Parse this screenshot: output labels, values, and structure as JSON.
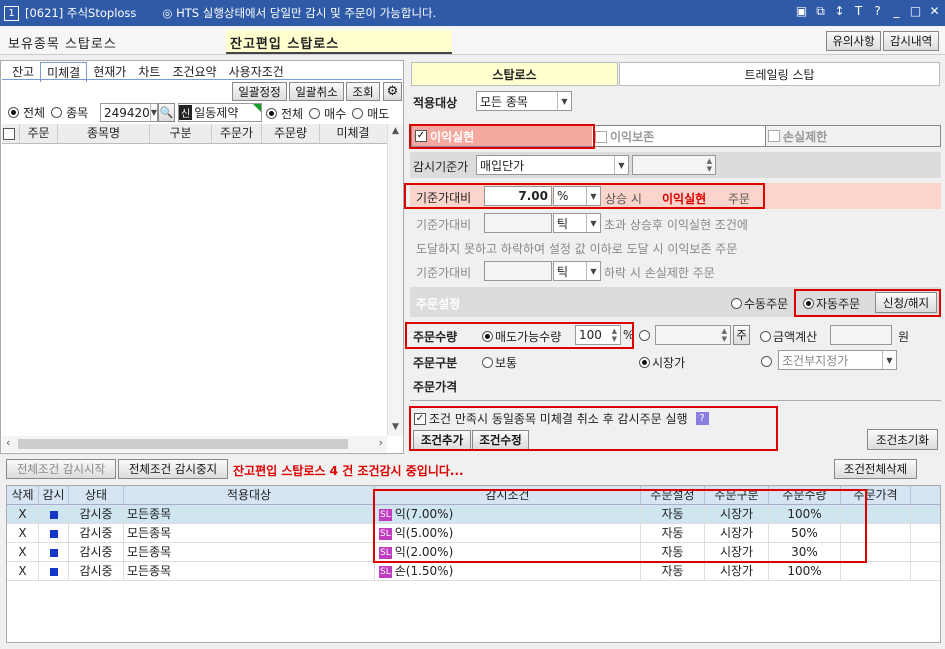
{
  "window": {
    "number": "1",
    "title": "[0621] 주식Stoploss",
    "notice": "◎ HTS 실행상태에서 당일만 감시 및 주문이 가능합니다.",
    "controls": [
      "▣",
      "⧉",
      "↕",
      "T",
      "?",
      "_",
      "□",
      "✕"
    ]
  },
  "header": {
    "holding_label": "보유종목 스탑로스",
    "balance_label": "잔고편입 스탑로스",
    "notice_button": "유의사항",
    "history_button": "감시내역"
  },
  "left": {
    "tabs": [
      "잔고",
      "미체결",
      "현재가",
      "차트",
      "조건요약",
      "사용자조건"
    ],
    "active_tab": "미체결",
    "buttons": {
      "bulk_modify": "일괄정정",
      "bulk_cancel": "일괄취소",
      "query": "조회"
    },
    "filter": {
      "all": "전체",
      "stock": "종목",
      "account": "249420",
      "badge": "신",
      "checked_label": "일동제약",
      "all2": "전체",
      "buy": "매수",
      "sell": "매도"
    },
    "columns": [
      "주문",
      "종목명",
      "구분",
      "주문가",
      "주문량",
      "미체결"
    ]
  },
  "right": {
    "tabs": [
      "스탑로스",
      "트레일링 스탑"
    ],
    "target_label": "적용대상",
    "target_value": "모든 종목",
    "checks": {
      "profit": "이익실현",
      "protect": "이익보존",
      "loss": "손실제한"
    },
    "base_price_label": "감시기준가",
    "base_price_value": "매입단가",
    "profit_row": {
      "label": "기준가대비",
      "value": "7.00",
      "unit": "%",
      "text1": "상승 시",
      "text2": "이익실현",
      "text3": "주문"
    },
    "protect_row": {
      "label": "기준가대비",
      "unit": "틱",
      "text": "초과 상승후 이익실현 조건에"
    },
    "protect_row2": "도달하지 못하고 하락하여 설정 값 이하로 도달 시  이익보존 주문",
    "loss_row": {
      "label": "기준가대비",
      "unit": "틱",
      "text": "하락 시 손실제한 주문"
    },
    "order_settings": {
      "label": "주문설정",
      "manual": "수동주문",
      "auto": "자동주문",
      "apply": "신청/해지"
    },
    "qty": {
      "label": "주문수량",
      "sellable": "매도가능수량",
      "value": "100",
      "unit": "%",
      "unit2": "주",
      "amount": "금액계산",
      "won": "원"
    },
    "order_type": {
      "label": "주문구분",
      "normal": "보통",
      "market": "시장가",
      "cond": "조건부지정가"
    },
    "order_price_label": "주문가격",
    "cancel_check": "조건 만족시 동일종목 미체결 취소 후 감시주문 실행",
    "add_cond": "조건추가",
    "edit_cond": "조건수정",
    "reset": "조건초기화"
  },
  "status": {
    "start_all": "전체조건 감시시작",
    "stop_all": "전체조건 감시중지",
    "message": "잔고편입 스탑로스 4 건 조건감시 중입니다...",
    "delete_all": "조건전체삭제"
  },
  "table": {
    "columns": [
      "삭제",
      "감시",
      "상태",
      "적용대상",
      "감시조건",
      "주문설정",
      "주문구분",
      "주문수량",
      "주문가격"
    ],
    "rows": [
      {
        "del": "X",
        "state": "감시중",
        "target": "모든종목",
        "cond": "익(7.00%)",
        "setting": "자동",
        "type": "시장가",
        "qty": "100%",
        "price": ""
      },
      {
        "del": "X",
        "state": "감시중",
        "target": "모든종목",
        "cond": "익(5.00%)",
        "setting": "자동",
        "type": "시장가",
        "qty": "50%",
        "price": ""
      },
      {
        "del": "X",
        "state": "감시중",
        "target": "모든종목",
        "cond": "익(2.00%)",
        "setting": "자동",
        "type": "시장가",
        "qty": "30%",
        "price": ""
      },
      {
        "del": "X",
        "state": "감시중",
        "target": "모든종목",
        "cond": "손(1.50%)",
        "setting": "자동",
        "type": "시장가",
        "qty": "100%",
        "price": ""
      }
    ]
  },
  "colors": {
    "titlebar": "#2f5aa8",
    "highlight_red": "#d00000",
    "profit_bg": "#f4a8a0",
    "row_selected": "#cfe6f0",
    "watch_square": "#1437c8",
    "sl_badge": "#c03cc0"
  }
}
